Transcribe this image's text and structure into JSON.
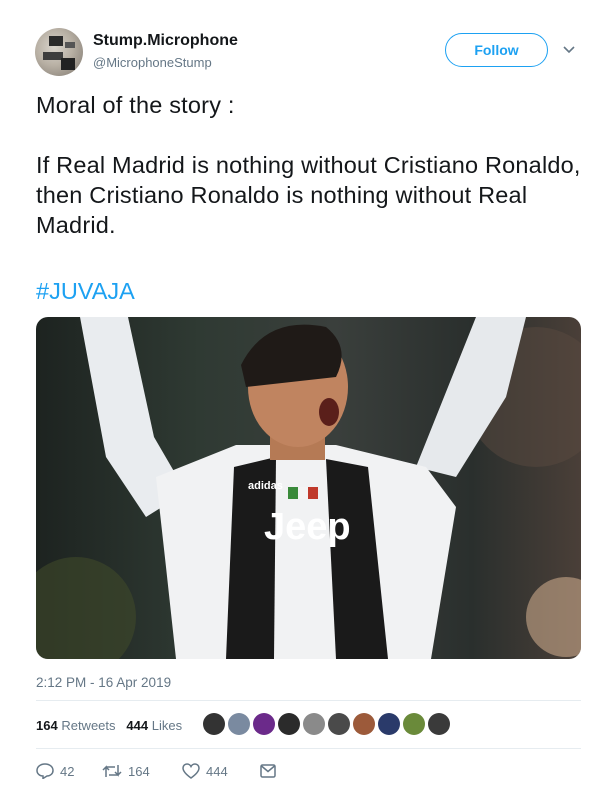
{
  "user": {
    "display_name": "Stump.Microphone",
    "handle": "@MicrophoneStump"
  },
  "follow_label": "Follow",
  "tweet": {
    "line1": "Moral of the story :",
    "line2": "If Real Madrid is nothing without Cristiano Ronaldo, then Cristiano Ronaldo is nothing without Real Madrid.",
    "hashtag": "#JUVAJA"
  },
  "photo": {
    "shirt_sponsor": "Jeep",
    "kit_brand": "adidas"
  },
  "timestamp": "2:12 PM - 16 Apr 2019",
  "stats": {
    "retweets_count": "164",
    "retweets_label": "Retweets",
    "likes_count": "444",
    "likes_label": "Likes"
  },
  "likers": [
    {
      "icon": "liker-avatar-1",
      "color": "#333333"
    },
    {
      "icon": "liker-avatar-2",
      "color": "#7a8aa0"
    },
    {
      "icon": "liker-avatar-3",
      "color": "#6b2a8a"
    },
    {
      "icon": "liker-avatar-4",
      "color": "#2b2b2b"
    },
    {
      "icon": "liker-avatar-5",
      "color": "#8a8a8a"
    },
    {
      "icon": "liker-avatar-6",
      "color": "#4a4a4a"
    },
    {
      "icon": "liker-avatar-7",
      "color": "#9c5a3a"
    },
    {
      "icon": "liker-avatar-8",
      "color": "#2a3a6a"
    },
    {
      "icon": "liker-avatar-9",
      "color": "#6a8a3a"
    },
    {
      "icon": "liker-avatar-10",
      "color": "#3a3a3a"
    }
  ],
  "actions": {
    "replies": "42",
    "retweets": "164",
    "likes": "444"
  },
  "colors": {
    "accent": "#1da1f2",
    "secondary_text": "#657786",
    "divider": "#e6ecf0"
  }
}
